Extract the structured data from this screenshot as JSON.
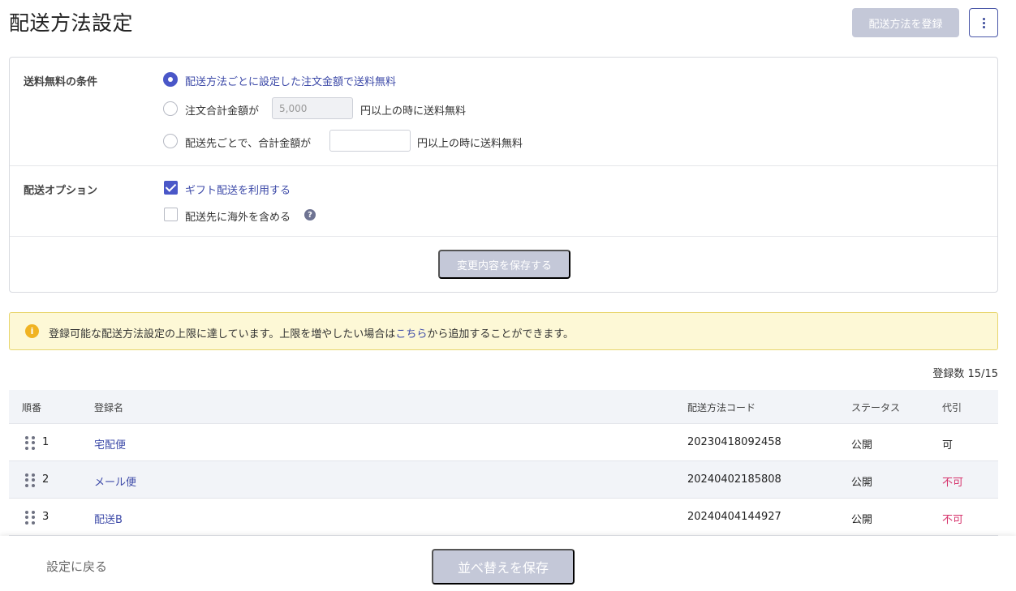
{
  "header": {
    "title": "配送方法設定",
    "register_button": "配送方法を登録"
  },
  "free_shipping": {
    "label": "送料無料の条件",
    "options": [
      {
        "label": "配送方法ごとに設定した注文金額で送料無料",
        "checked": true
      },
      {
        "label_before": "注文合計金額が",
        "input_value": "5,000",
        "label_after": "円以上の時に送料無料",
        "checked": false
      },
      {
        "label_before": "配送先ごとで、合計金額が",
        "input_value": "",
        "label_after": "円以上の時に送料無料",
        "checked": false
      }
    ]
  },
  "shipping_options": {
    "label": "配送オプション",
    "gift": {
      "label": "ギフト配送を利用する",
      "checked": true
    },
    "overseas": {
      "label": "配送先に海外を含める",
      "checked": false,
      "help": "?"
    }
  },
  "save_changes_button": "変更内容を保存する",
  "notice": {
    "icon": "i",
    "text_before": "登録可能な配送方法設定の上限に達しています。上限を増やしたい場合は",
    "link": "こちら",
    "text_after": "から追加することができます。"
  },
  "count_text": "登録数 15/15",
  "table": {
    "headers": {
      "order": "順番",
      "name": "登録名",
      "code": "配送方法コード",
      "status": "ステータス",
      "cod": "代引"
    },
    "rows": [
      {
        "order": "1",
        "name": "宅配便",
        "code": "20230418092458",
        "status": "公開",
        "cod": "可"
      },
      {
        "order": "2",
        "name": "メール便",
        "code": "20240402185808",
        "status": "公開",
        "cod": "不可"
      },
      {
        "order": "3",
        "name": "配送B",
        "code": "20240404144927",
        "status": "公開",
        "cod": "不可"
      }
    ]
  },
  "footer": {
    "back_label": "設定に戻る",
    "save_order_button": "並べ替えを保存"
  },
  "colors": {
    "accent": "#4a57c8",
    "disabled_button": "#c4c8d8",
    "link": "#3d4aa8",
    "ng": "#d6336c",
    "notice_bg": "#fdf8d6",
    "notice_icon": "#f0b323"
  }
}
